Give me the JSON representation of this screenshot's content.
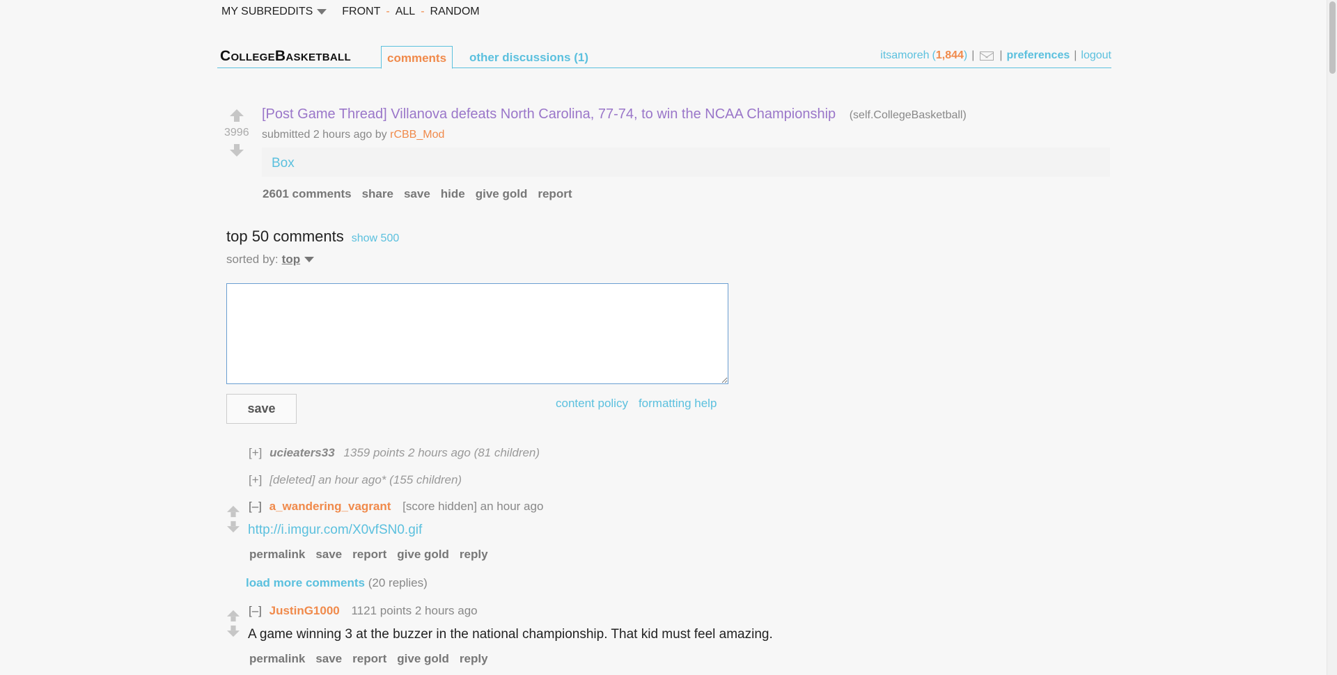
{
  "topbar": {
    "my_subreddits": "MY SUBREDDITS",
    "links": [
      "FRONT",
      "ALL",
      "RANDOM"
    ],
    "separator": "-"
  },
  "header": {
    "subreddit": "CollegeBasketball",
    "tab_active": "comments",
    "tab_other": "other discussions (1)",
    "user": {
      "name": "itsamoreh",
      "karma": "1,844",
      "preferences": "preferences",
      "logout": "logout"
    }
  },
  "post": {
    "score": "3996",
    "title": "[Post Game Thread] Villanova defeats North Carolina, 77-74, to win the NCAA Championship",
    "domain": "(self.CollegeBasketball)",
    "submitted": "submitted 2 hours ago by",
    "author": "rCBB_Mod",
    "selftext_link": "Box",
    "buttons": [
      "2601 comments",
      "share",
      "save",
      "hide",
      "give gold",
      "report"
    ]
  },
  "comments_section": {
    "heading": "top 50 comments",
    "show_more": "show 500",
    "sorted_by_label": "sorted by:",
    "sorted_by_value": "top",
    "save_label": "save",
    "content_policy": "content policy",
    "formatting_help": "formatting help"
  },
  "collapsed_comments": [
    {
      "expand": "[+]",
      "author": "ucieaters33",
      "meta": "1359 points 2 hours ago (81 children)"
    },
    {
      "expand": "[+]",
      "author": "",
      "meta": "[deleted] an hour ago* (155 children)"
    }
  ],
  "comments": [
    {
      "toggle": "[–]",
      "author": "a_wandering_vagrant",
      "meta": "[score hidden] an hour ago",
      "body": "http://i.imgur.com/X0vfSN0.gif",
      "buttons": [
        "permalink",
        "save",
        "report",
        "give gold",
        "reply"
      ]
    },
    {
      "toggle": "[–]",
      "author": "JustinG1000",
      "meta": "1121 points 2 hours ago",
      "body": "A game winning 3 at the buzzer in the national championship. That kid must feel amazing.",
      "buttons": [
        "permalink",
        "save",
        "report",
        "give gold",
        "reply"
      ]
    }
  ],
  "load_more": {
    "link": "load more comments",
    "count": "(20 replies)"
  },
  "colors": {
    "accent_orange": "#f08a4b",
    "link_blue": "#5bc0de",
    "visited_purple": "#9a76c9"
  }
}
